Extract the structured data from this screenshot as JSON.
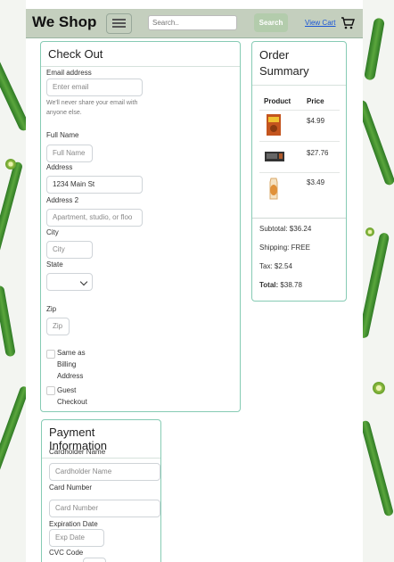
{
  "navbar": {
    "brand": "We Shop",
    "search_placeholder": "Search..",
    "search_button": "Search",
    "view_cart": "View Cart"
  },
  "checkout": {
    "title": "Check Out",
    "email_label": "Email address",
    "email_placeholder": "Enter email",
    "email_help": "We'll never share your email with anyone else.",
    "fullname_label": "Full Name",
    "fullname_placeholder": "Full Name",
    "address_label": "Address",
    "address_value": "1234 Main St",
    "address2_label": "Address 2",
    "address2_placeholder": "Apartment, studio, or floo",
    "city_label": "City",
    "city_placeholder": "City",
    "state_label": "State",
    "state_value": "",
    "zip_label": "Zip",
    "zip_placeholder": "Zip",
    "same_as_billing": [
      "Same as",
      "Billing",
      "Address"
    ],
    "guest_checkout": [
      "Guest",
      "Checkout"
    ]
  },
  "order_summary": {
    "title": "Order Summary",
    "col_product": "Product",
    "col_price": "Price",
    "items": [
      {
        "price": "$4.99",
        "icon": "cereal-box-icon"
      },
      {
        "price": "$27.76",
        "icon": "electronics-box-icon"
      },
      {
        "price": "$3.49",
        "icon": "bread-bag-icon"
      }
    ],
    "subtotal": "Subtotal: $36.24",
    "shipping": "Shipping: FREE",
    "tax": "Tax: $2.54",
    "total_label": "Total:",
    "total_value": "$38.78"
  },
  "payment": {
    "title": "Payment Information",
    "cardholder_label": "Cardholder Name",
    "cardholder_placeholder": "Cardholder Name",
    "card_number_label": "Card Number",
    "card_number_placeholder": "Card Number",
    "expiration_label": "Expiration Date",
    "expiration_placeholder": "Exp Date",
    "cvc_label": "CVC Code"
  },
  "colors": {
    "navbar_bg": "#c4cfbe",
    "search_button_bg": "#b3ccac",
    "card_border": "#86cbb4",
    "link": "#1a56d6"
  }
}
